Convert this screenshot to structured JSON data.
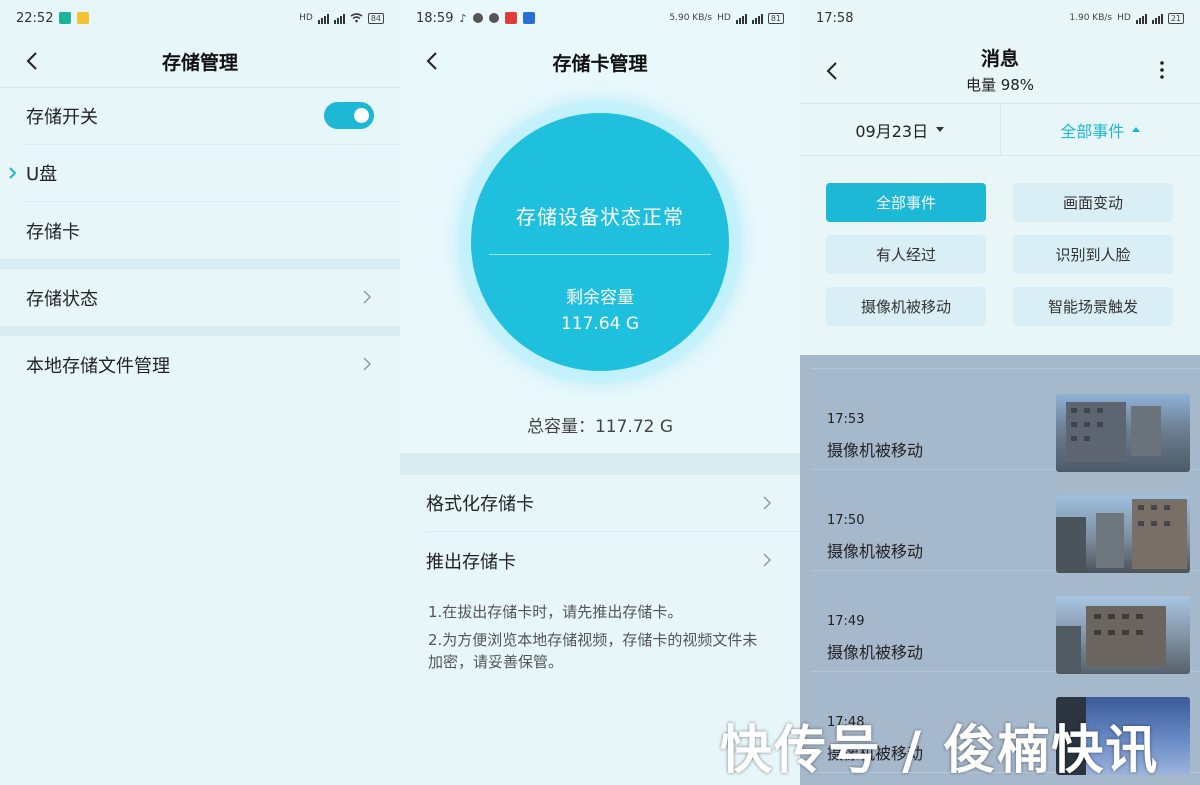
{
  "panel1": {
    "status": {
      "time": "22:52",
      "battery": "84"
    },
    "title": "存储管理",
    "rows": {
      "switch": "存储开关",
      "usb": "U盘",
      "card": "存储卡",
      "status": "存储状态",
      "files": "本地存储文件管理"
    },
    "switch_on": true
  },
  "panel2": {
    "status": {
      "time": "18:59",
      "speed": "5.90 KB/s",
      "battery": "81"
    },
    "title": "存储卡管理",
    "state_text": "存储设备状态正常",
    "remaining_label": "剩余容量",
    "remaining_value": "117.64 G",
    "total_text": "总容量：117.72 G",
    "actions": {
      "format": "格式化存储卡",
      "eject": "推出存储卡"
    },
    "notes": [
      "1.在拔出存储卡时，请先推出存储卡。",
      "2.为方便浏览本地存储视频，存储卡的视频文件未加密，请妥善保管。"
    ]
  },
  "panel3": {
    "status": {
      "time": "17:58",
      "speed": "1.90 KB/s",
      "battery": "21"
    },
    "title": "消息",
    "subtitle": "电量 98%",
    "date_filter": "09月23日",
    "event_filter": "全部事件",
    "chips": [
      "全部事件",
      "画面变动",
      "有人经过",
      "识别到人脸",
      "摄像机被移动",
      "智能场景触发"
    ],
    "events": [
      {
        "time": "17:53",
        "label": "摄像机被移动"
      },
      {
        "time": "17:50",
        "label": "摄像机被移动"
      },
      {
        "time": "17:49",
        "label": "摄像机被移动"
      },
      {
        "time": "17:48",
        "label": "摄像机被移动"
      }
    ]
  },
  "watermark": "快传号 / 俊楠快讯",
  "colors": {
    "accent": "#1cb8d6",
    "background": "#e6f6f9",
    "overlay": "#a6b8cc"
  }
}
